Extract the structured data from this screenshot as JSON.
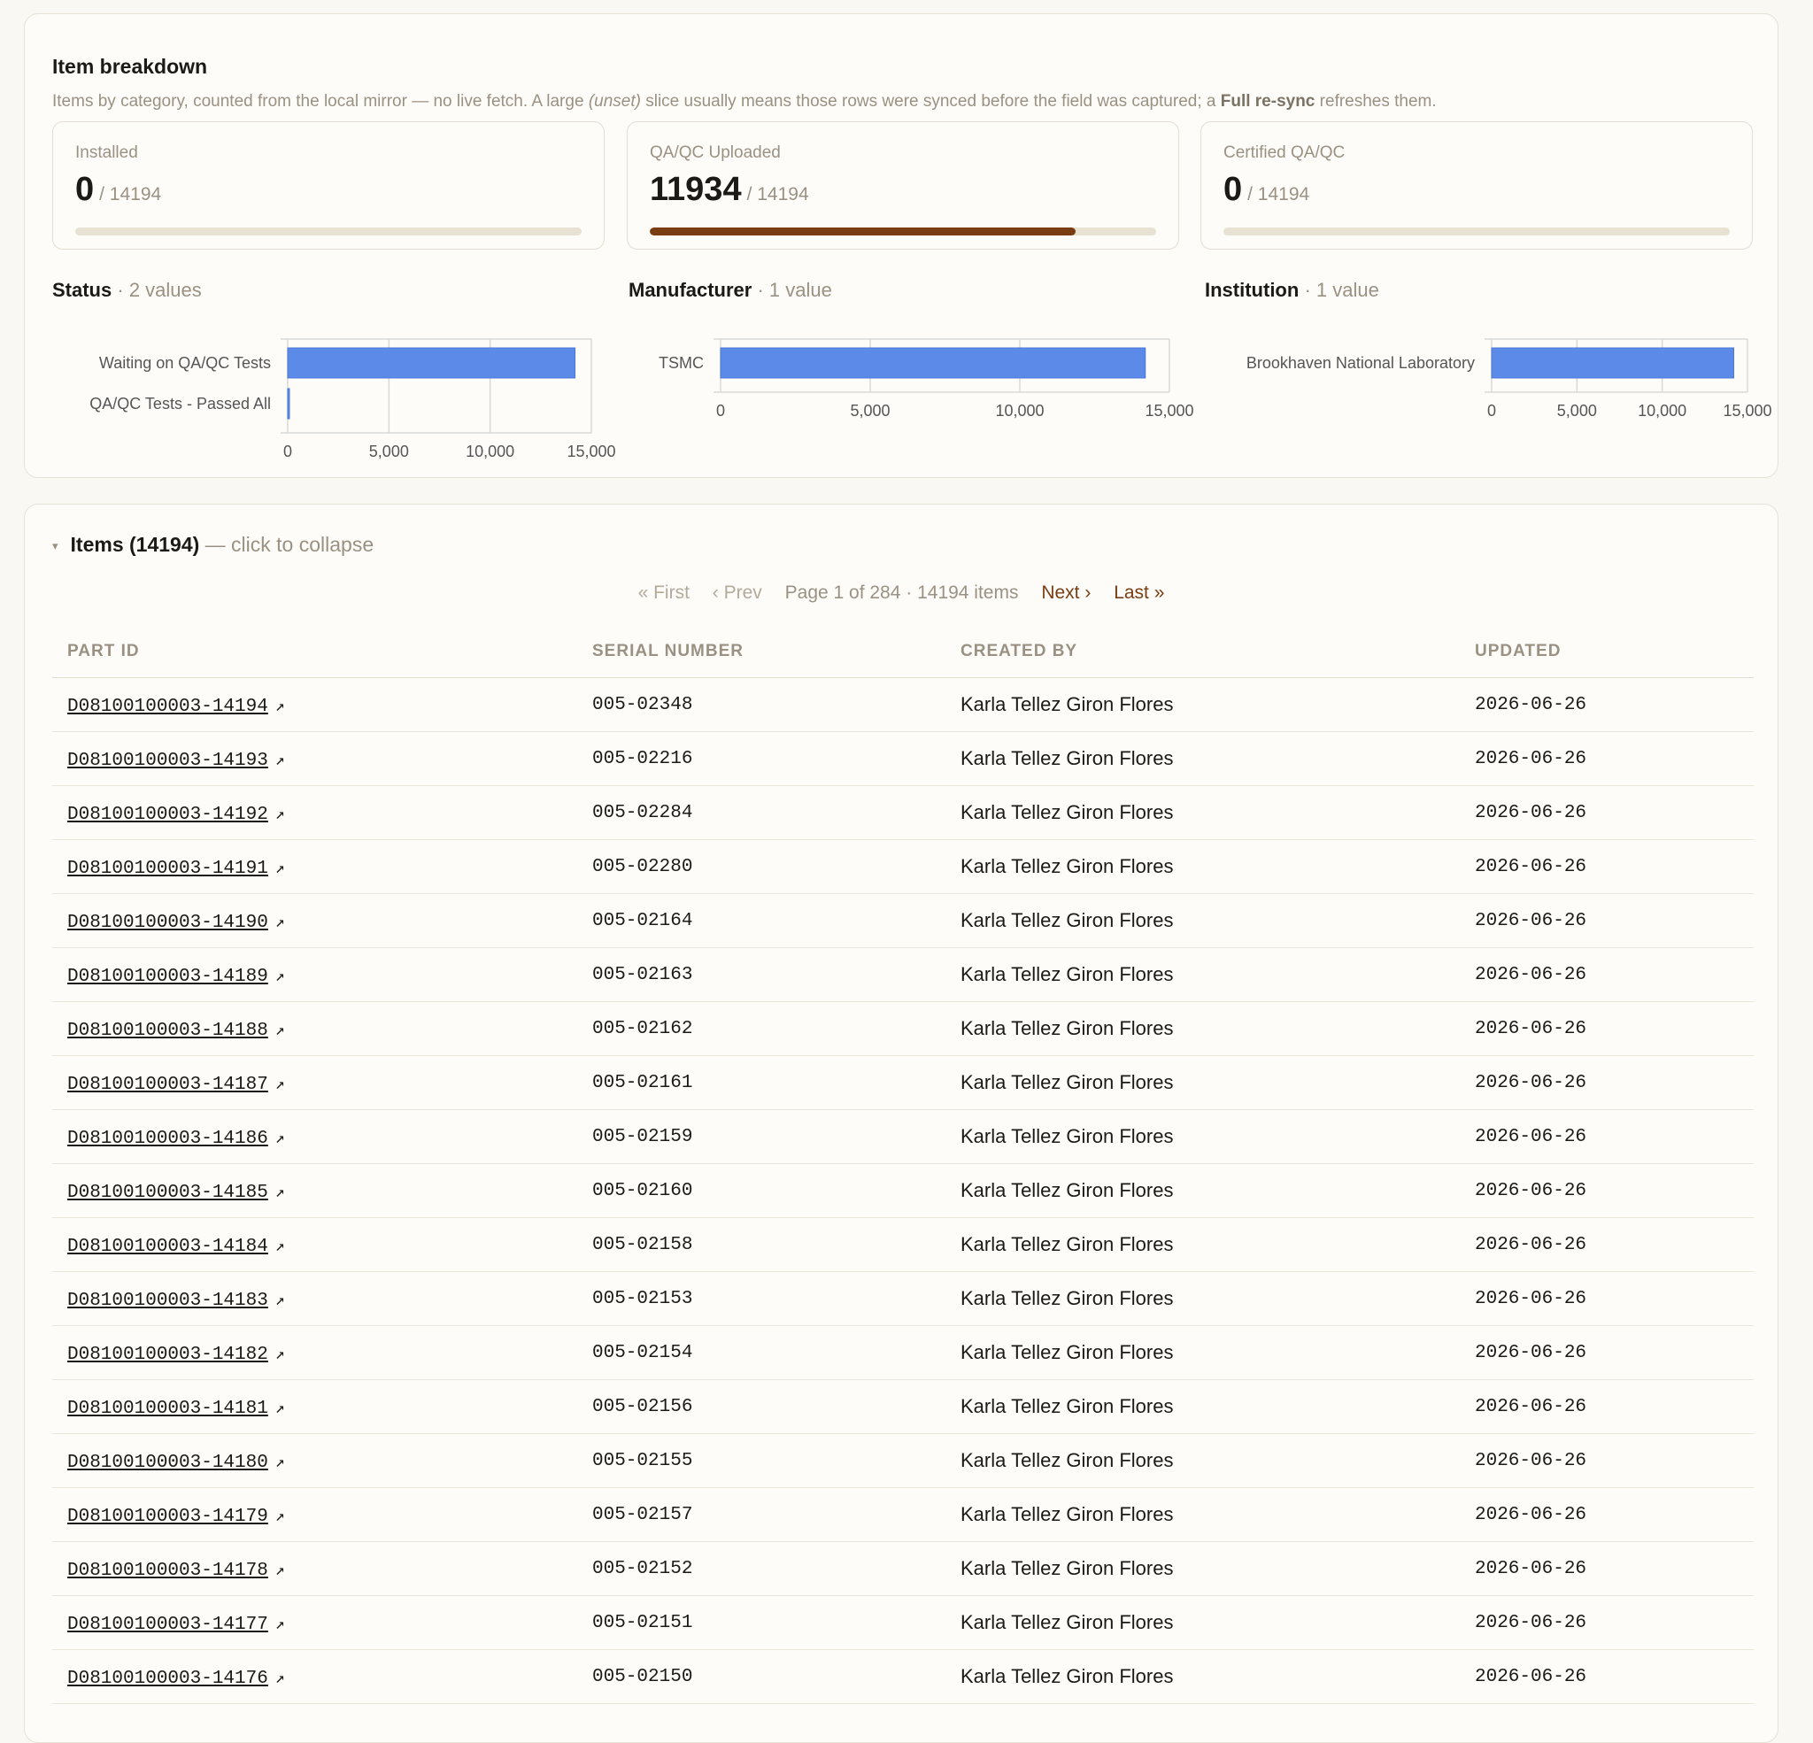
{
  "breakdown": {
    "title": "Item breakdown",
    "desc_prefix": "Items by category, counted from the local mirror — no live fetch. A large ",
    "desc_unset": "(unset)",
    "desc_mid": " slice usually means those rows were synced before the field was captured; a ",
    "desc_bold": "Full re-sync",
    "desc_suffix": " refreshes them.",
    "stats": [
      {
        "label": "Installed",
        "value": "0",
        "total": "/ 14194",
        "fraction": 0.0
      },
      {
        "label": "QA/QC Uploaded",
        "value": "11934",
        "total": "/ 14194",
        "fraction": 0.8408
      },
      {
        "label": "Certified QA/QC",
        "value": "0",
        "total": "/ 14194",
        "fraction": 0.0
      }
    ],
    "accent_color": "#7a3d12",
    "bar_color": "#5b8ae8"
  },
  "chart_data": [
    {
      "type": "bar",
      "orientation": "horizontal",
      "title": "Status",
      "subtitle": "· 2 values",
      "categories": [
        "Waiting on QA/QC Tests",
        "QA/QC Tests - Passed All"
      ],
      "values": [
        14193,
        1
      ],
      "xlim": [
        0,
        15000
      ],
      "xticks": [
        "0",
        "5,000",
        "10,000",
        "15,000"
      ],
      "grid": true
    },
    {
      "type": "bar",
      "orientation": "horizontal",
      "title": "Manufacturer",
      "subtitle": "· 1 value",
      "categories": [
        "TSMC"
      ],
      "values": [
        14194
      ],
      "xlim": [
        0,
        15000
      ],
      "xticks": [
        "0",
        "5,000",
        "10,000",
        "15,000"
      ],
      "grid": true
    },
    {
      "type": "bar",
      "orientation": "horizontal",
      "title": "Institution",
      "subtitle": "· 1 value",
      "categories": [
        "Brookhaven National Laboratory"
      ],
      "values": [
        14194
      ],
      "xlim": [
        0,
        15000
      ],
      "xticks": [
        "0",
        "5,000",
        "10,000",
        "15,000"
      ],
      "grid": true
    }
  ],
  "items": {
    "caret": "▾",
    "title": "Items (14194)",
    "hint": " — click to collapse",
    "pager": {
      "first": "« First",
      "prev": "‹ Prev",
      "info": "Page 1 of 284 · 14194 items",
      "next": "Next ›",
      "last": "Last »"
    },
    "columns": [
      "PART ID",
      "SERIAL NUMBER",
      "CREATED BY",
      "UPDATED"
    ],
    "link_icon": "↗",
    "rows": [
      {
        "part_id": "D08100100003-14194",
        "serial": "005-02348",
        "created_by": "Karla Tellez Giron Flores",
        "updated": "2026-06-26"
      },
      {
        "part_id": "D08100100003-14193",
        "serial": "005-02216",
        "created_by": "Karla Tellez Giron Flores",
        "updated": "2026-06-26"
      },
      {
        "part_id": "D08100100003-14192",
        "serial": "005-02284",
        "created_by": "Karla Tellez Giron Flores",
        "updated": "2026-06-26"
      },
      {
        "part_id": "D08100100003-14191",
        "serial": "005-02280",
        "created_by": "Karla Tellez Giron Flores",
        "updated": "2026-06-26"
      },
      {
        "part_id": "D08100100003-14190",
        "serial": "005-02164",
        "created_by": "Karla Tellez Giron Flores",
        "updated": "2026-06-26"
      },
      {
        "part_id": "D08100100003-14189",
        "serial": "005-02163",
        "created_by": "Karla Tellez Giron Flores",
        "updated": "2026-06-26"
      },
      {
        "part_id": "D08100100003-14188",
        "serial": "005-02162",
        "created_by": "Karla Tellez Giron Flores",
        "updated": "2026-06-26"
      },
      {
        "part_id": "D08100100003-14187",
        "serial": "005-02161",
        "created_by": "Karla Tellez Giron Flores",
        "updated": "2026-06-26"
      },
      {
        "part_id": "D08100100003-14186",
        "serial": "005-02159",
        "created_by": "Karla Tellez Giron Flores",
        "updated": "2026-06-26"
      },
      {
        "part_id": "D08100100003-14185",
        "serial": "005-02160",
        "created_by": "Karla Tellez Giron Flores",
        "updated": "2026-06-26"
      },
      {
        "part_id": "D08100100003-14184",
        "serial": "005-02158",
        "created_by": "Karla Tellez Giron Flores",
        "updated": "2026-06-26"
      },
      {
        "part_id": "D08100100003-14183",
        "serial": "005-02153",
        "created_by": "Karla Tellez Giron Flores",
        "updated": "2026-06-26"
      },
      {
        "part_id": "D08100100003-14182",
        "serial": "005-02154",
        "created_by": "Karla Tellez Giron Flores",
        "updated": "2026-06-26"
      },
      {
        "part_id": "D08100100003-14181",
        "serial": "005-02156",
        "created_by": "Karla Tellez Giron Flores",
        "updated": "2026-06-26"
      },
      {
        "part_id": "D08100100003-14180",
        "serial": "005-02155",
        "created_by": "Karla Tellez Giron Flores",
        "updated": "2026-06-26"
      },
      {
        "part_id": "D08100100003-14179",
        "serial": "005-02157",
        "created_by": "Karla Tellez Giron Flores",
        "updated": "2026-06-26"
      },
      {
        "part_id": "D08100100003-14178",
        "serial": "005-02152",
        "created_by": "Karla Tellez Giron Flores",
        "updated": "2026-06-26"
      },
      {
        "part_id": "D08100100003-14177",
        "serial": "005-02151",
        "created_by": "Karla Tellez Giron Flores",
        "updated": "2026-06-26"
      },
      {
        "part_id": "D08100100003-14176",
        "serial": "005-02150",
        "created_by": "Karla Tellez Giron Flores",
        "updated": "2026-06-26"
      }
    ]
  }
}
